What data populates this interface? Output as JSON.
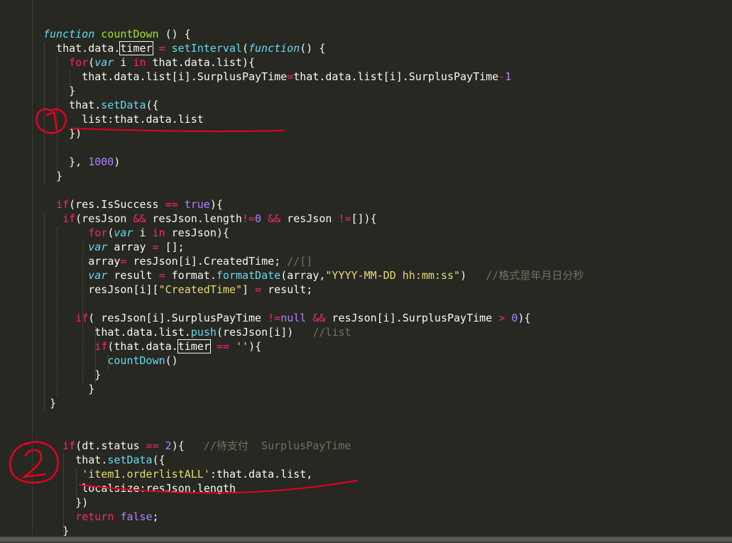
{
  "editor": {
    "theme_colors": {
      "background": "#272822",
      "keyword": "#f92672",
      "function": "#a6e22e",
      "storage": "#66d9ef",
      "number": "#ae81ff",
      "string": "#e6db74",
      "comment": "#75715e",
      "annotation": "#e8001f"
    },
    "annotations": [
      "1",
      "2"
    ],
    "code": {
      "l1": {
        "a": "function",
        "b": " ",
        "c": "countDown",
        "d": " () {"
      },
      "l2": {
        "a": "  that.data.",
        "b": "timer",
        "c": " ",
        "d": "=",
        "e": " ",
        "f": "setInterval",
        "g": "(",
        "h": "function",
        "i": "() {"
      },
      "l3": {
        "a": "    ",
        "b": "for",
        "c": "(",
        "d": "var",
        "e": " i ",
        "f": "in",
        "g": " that.data.list){"
      },
      "l4": {
        "a": "      that.data.list[i].SurplusPayTime",
        "b": "=",
        "c": "that.data.list[i].SurplusPayTime",
        "d": "-",
        "e": "1"
      },
      "l5": {
        "a": "    }"
      },
      "l6": {
        "a": "    that.",
        "b": "setData",
        "c": "({"
      },
      "l7": {
        "a": "      list:that.data.list"
      },
      "l8": {
        "a": "    })"
      },
      "l9": {
        "a": ""
      },
      "l10": {
        "a": "    }, ",
        "b": "1000",
        "c": ")"
      },
      "l11": {
        "a": "  }"
      },
      "l12": {
        "a": ""
      },
      "l13": {
        "a": "  ",
        "b": "if",
        "c": "(res.IsSuccess ",
        "d": "==",
        "e": " ",
        "f": "true",
        "g": "){"
      },
      "l14": {
        "a": "   ",
        "b": "if",
        "c": "(resJson ",
        "d": "&&",
        "e": " resJson.length",
        "f": "!=",
        "g": "0",
        "h": " ",
        "i": "&&",
        "j": " resJson ",
        "k": "!=",
        "l": "[]){"
      },
      "l15": {
        "a": "        ",
        "b": "for",
        "c": "(",
        "d": "var",
        "e": " i ",
        "f": "in",
        "g": " resJson){"
      },
      "l16": {
        "a": "        ",
        "b": "var",
        "c": " array ",
        "d": "=",
        "e": " [];"
      },
      "l17": {
        "a": "        array",
        "b": "=",
        "c": " resJson[i].CreatedTime; ",
        "d": "//[]"
      },
      "l18": {
        "a": "        ",
        "b": "var",
        "c": " result ",
        "d": "=",
        "e": " format.",
        "f": "formatDate",
        "g": "(array,",
        "h": "\"YYYY-MM-DD hh:mm:ss\"",
        "i": ")   ",
        "j": "//格式是年月日分秒"
      },
      "l19": {
        "a": "        resJson[i][",
        "b": "\"CreatedTime\"",
        "c": "] ",
        "d": "=",
        "e": " result;"
      },
      "l20": {
        "a": ""
      },
      "l21": {
        "a": "      ",
        "b": "if",
        "c": "( resJson[i].SurplusPayTime ",
        "d": "!=",
        "e": "null",
        "f": " ",
        "g": "&&",
        "h": " resJson[i].SurplusPayTime ",
        "i": ">",
        "j": " ",
        "k": "0",
        "l": "){"
      },
      "l22": {
        "a": "          that.data.list.",
        "b": "push",
        "c": "(resJson[i])   ",
        "d": "//list"
      },
      "l23": {
        "a": "          ",
        "b": "if",
        "c": "(that.data.",
        "d": "timer",
        "e": " ",
        "f": "==",
        "g": " ",
        "h": "''",
        "i": "){"
      },
      "l24": {
        "a": "            ",
        "b": "countDown",
        "c": "()"
      },
      "l25": {
        "a": "          }"
      },
      "l26": {
        "a": "        }"
      },
      "l27": {
        "a": "  }"
      },
      "l28": {
        "a": ""
      },
      "l29": {
        "a": ""
      },
      "l30": {
        "a": "     ",
        "b": "if",
        "c": "(dt.status ",
        "d": "==",
        "e": " ",
        "f": "2",
        "g": "){   ",
        "h": "//待支付  SurplusPayTime"
      },
      "l31": {
        "a": "       that.",
        "b": "setData",
        "c": "({"
      },
      "l32": {
        "a": "        ",
        "b": "'item1.orderlistALL'",
        "c": ":that.data.list,"
      },
      "l33": {
        "a": "        localsize:resJson.length"
      },
      "l34": {
        "a": "       })"
      },
      "l35": {
        "a": "       ",
        "b": "return",
        "c": " ",
        "d": "false",
        "e": ";"
      },
      "l36": {
        "a": "     }"
      }
    }
  }
}
